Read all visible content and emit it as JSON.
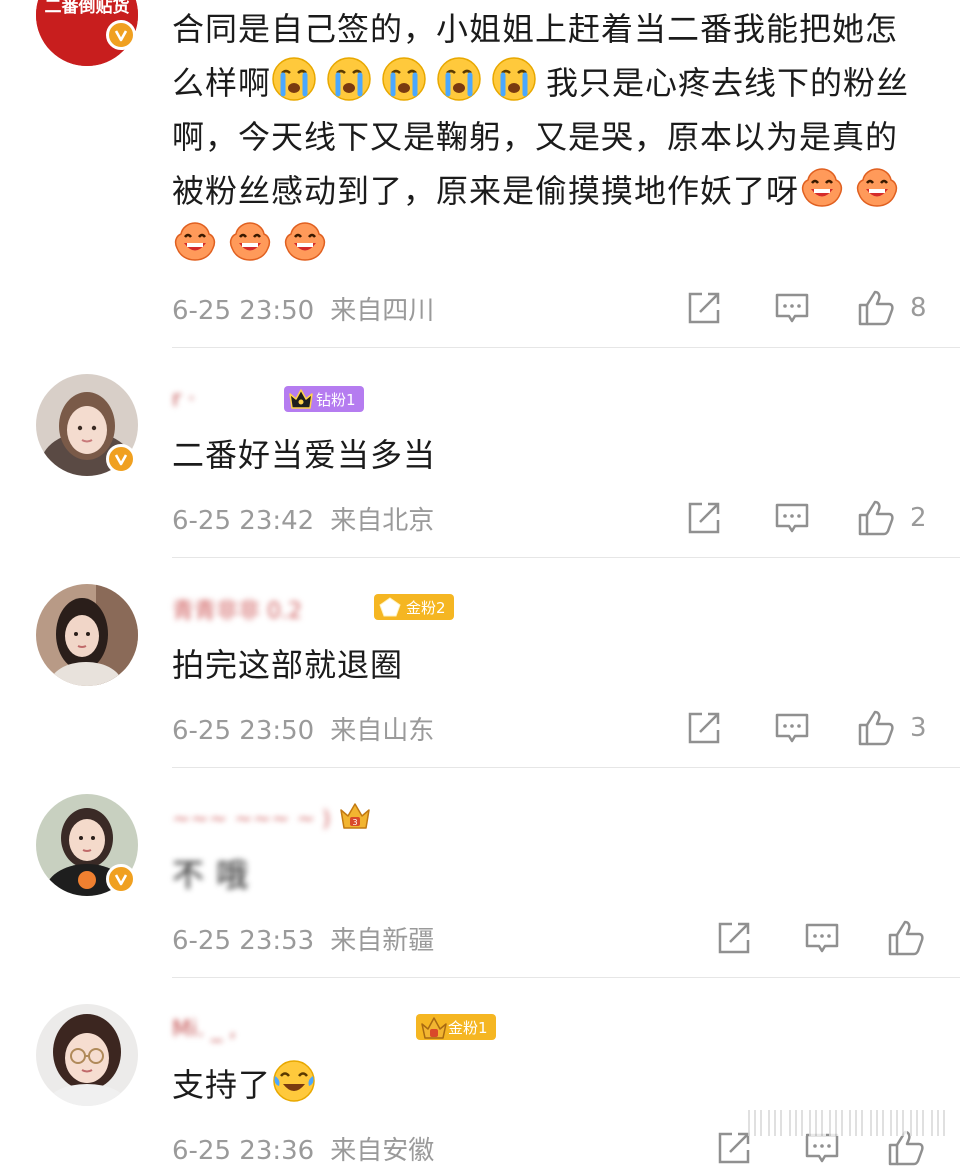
{
  "top_avatar_text": "二番倒贴货",
  "comments": [
    {
      "text_parts": [
        "合同是自己签的，小姐姐上赶着当二番我能把她怎么样啊",
        "我只是心疼去线下的粉丝啊，今天线下又是鞠躬，又是哭，原本以为是真的被粉丝感动到了，原来是偷摸摸地作妖了呀"
      ],
      "date": "6-25 23:50",
      "location": "来自四川",
      "likes": "8"
    },
    {
      "username": "r              ·",
      "fan_badge": "钻粉1",
      "text": "二番好当爱当多当",
      "date": "6-25 23:42",
      "location": "来自北京",
      "likes": "2"
    },
    {
      "username": "青青非非 0.2",
      "fan_badge": "金粉2",
      "text": "拍完这部就退圈",
      "date": "6-25 23:50",
      "location": "来自山东",
      "likes": "3"
    },
    {
      "username": "~~~  ~~~ ~ )",
      "text": "不         哦",
      "date": "6-25 23:53",
      "location": "来自新疆",
      "likes": ""
    },
    {
      "username": "Mi.                    _  ,",
      "fan_badge": "金粉1",
      "text": "支持了",
      "date": "6-25 23:36",
      "location": "来自安徽",
      "likes": ""
    }
  ],
  "colors": {
    "verified_badge": "#f0a020",
    "diamond_fan_badge": "#b57cf0",
    "gold_fan_badge": "#f5b622",
    "meta_text": "#9a9a9a"
  },
  "icons": [
    "share-icon",
    "comment-icon",
    "like-icon",
    "cry-emoji",
    "laugh-emoji",
    "tears-of-joy-emoji"
  ]
}
